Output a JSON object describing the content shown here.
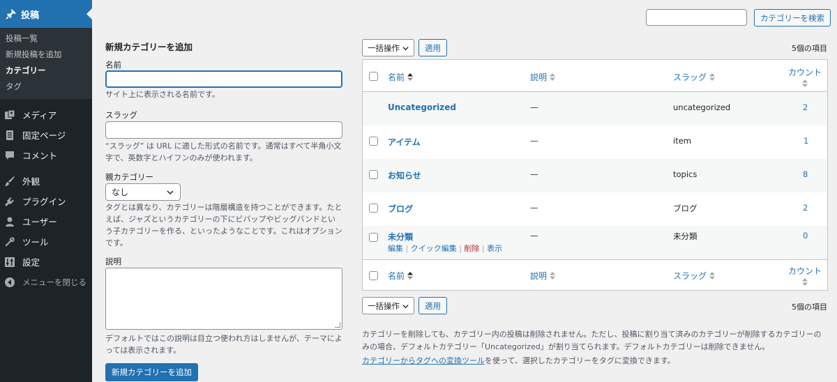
{
  "sidebar": {
    "active": "投稿",
    "submenu": [
      "投稿一覧",
      "新規投稿を追加",
      "カテゴリー",
      "タグ"
    ],
    "items": [
      "メディア",
      "固定ページ",
      "コメント",
      "外観",
      "プラグイン",
      "ユーザー",
      "ツール",
      "設定"
    ],
    "collapse": "メニューを閉じる"
  },
  "search": {
    "button": "カテゴリーを検索"
  },
  "form": {
    "title": "新規カテゴリーを追加",
    "name_label": "名前",
    "name_desc": "サイト上に表示される名前です。",
    "slug_label": "スラッグ",
    "slug_desc": "“スラッグ” は URL に適した形式の名前です。通常はすべて半角小文字で、英数字とハイフンのみが使われます。",
    "parent_label": "親カテゴリー",
    "parent_value": "なし",
    "parent_desc": "タグとは異なり、カテゴリーは階層構造を持つことができます。たとえば、ジャズというカテゴリーの下にビバップやビッグバンドという子カテゴリーを作る、といったようなことです。これはオプションです。",
    "description_label": "説明",
    "description_desc": "デフォルトではこの説明は目立つ使われ方はしませんが、テーマによっては表示されます。",
    "submit": "新規カテゴリーを追加"
  },
  "bulk": {
    "label": "一括操作",
    "apply": "適用",
    "count": "5個の項目"
  },
  "table": {
    "headers": {
      "name": "名前",
      "description": "説明",
      "slug": "スラッグ",
      "count": "カウント"
    },
    "rows": [
      {
        "name": "Uncategorized",
        "description": "—",
        "slug": "uncategorized",
        "count": "2"
      },
      {
        "name": "アイテム",
        "description": "—",
        "slug": "item",
        "count": "1"
      },
      {
        "name": "お知らせ",
        "description": "—",
        "slug": "topics",
        "count": "8"
      },
      {
        "name": "ブログ",
        "description": "—",
        "slug": "ブログ",
        "count": "2"
      },
      {
        "name": "未分類",
        "description": "—",
        "slug": "未分類",
        "count": "0"
      }
    ],
    "row_actions": {
      "edit": "編集",
      "quick_edit": "クイック編集",
      "delete": "削除",
      "view": "表示"
    }
  },
  "notes": {
    "delete_note": "カテゴリーを削除しても、カテゴリー内の投稿は削除されません。ただし、投稿に割り当て済みのカテゴリーが削除するカテゴリーのみの場合、デフォルトカテゴリー「Uncategorized」が割り当てられます。デフォルトカテゴリーは削除できません。",
    "converter_link": "カテゴリーからタグへの変換ツール",
    "converter_text": "を使って、選択したカテゴリーをタグに変換できます。"
  },
  "colors": {
    "accent": "#2271b1",
    "sidebar": "#1d2327",
    "delete": "#b32d2e"
  }
}
